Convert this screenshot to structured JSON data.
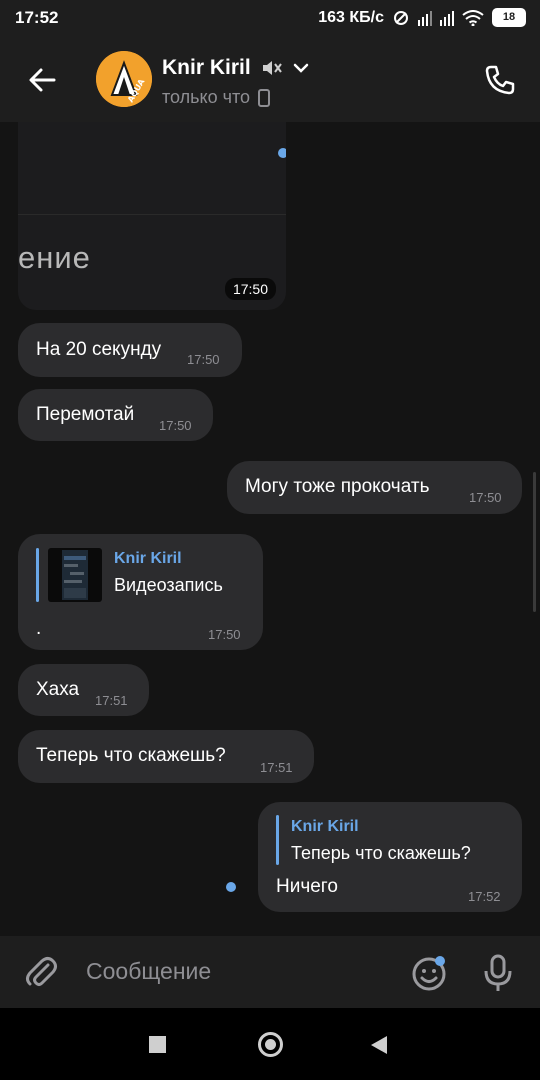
{
  "status": {
    "time": "17:52",
    "speed": "163 КБ/с",
    "battery": "18"
  },
  "header": {
    "title": "Knir Kiril",
    "subtitle": "только что",
    "avatar_text": "AQUA"
  },
  "messages": {
    "media": {
      "text": "ение",
      "time": "17:50"
    },
    "m1": {
      "text": "На 20 секунду",
      "time": "17:50"
    },
    "m2": {
      "text": "Перемотай",
      "time": "17:50"
    },
    "m3": {
      "text": "Могу тоже прокочать",
      "time": "17:50"
    },
    "m4": {
      "reply_name": "Knir Kiril",
      "reply_text": "Видеозапись",
      "text": ".",
      "time": "17:50"
    },
    "m5": {
      "text": "Хаха",
      "time": "17:51"
    },
    "m6": {
      "text": "Теперь что скажешь?",
      "time": "17:51"
    },
    "m7": {
      "reply_name": "Knir Kiril",
      "reply_text": "Теперь что скажешь?",
      "text": "Ничего",
      "time": "17:52"
    }
  },
  "input": {
    "placeholder": "Сообщение"
  },
  "colors": {
    "accent": "#6aa7e8",
    "bubble": "#2c2c2e",
    "background": "#141414"
  }
}
